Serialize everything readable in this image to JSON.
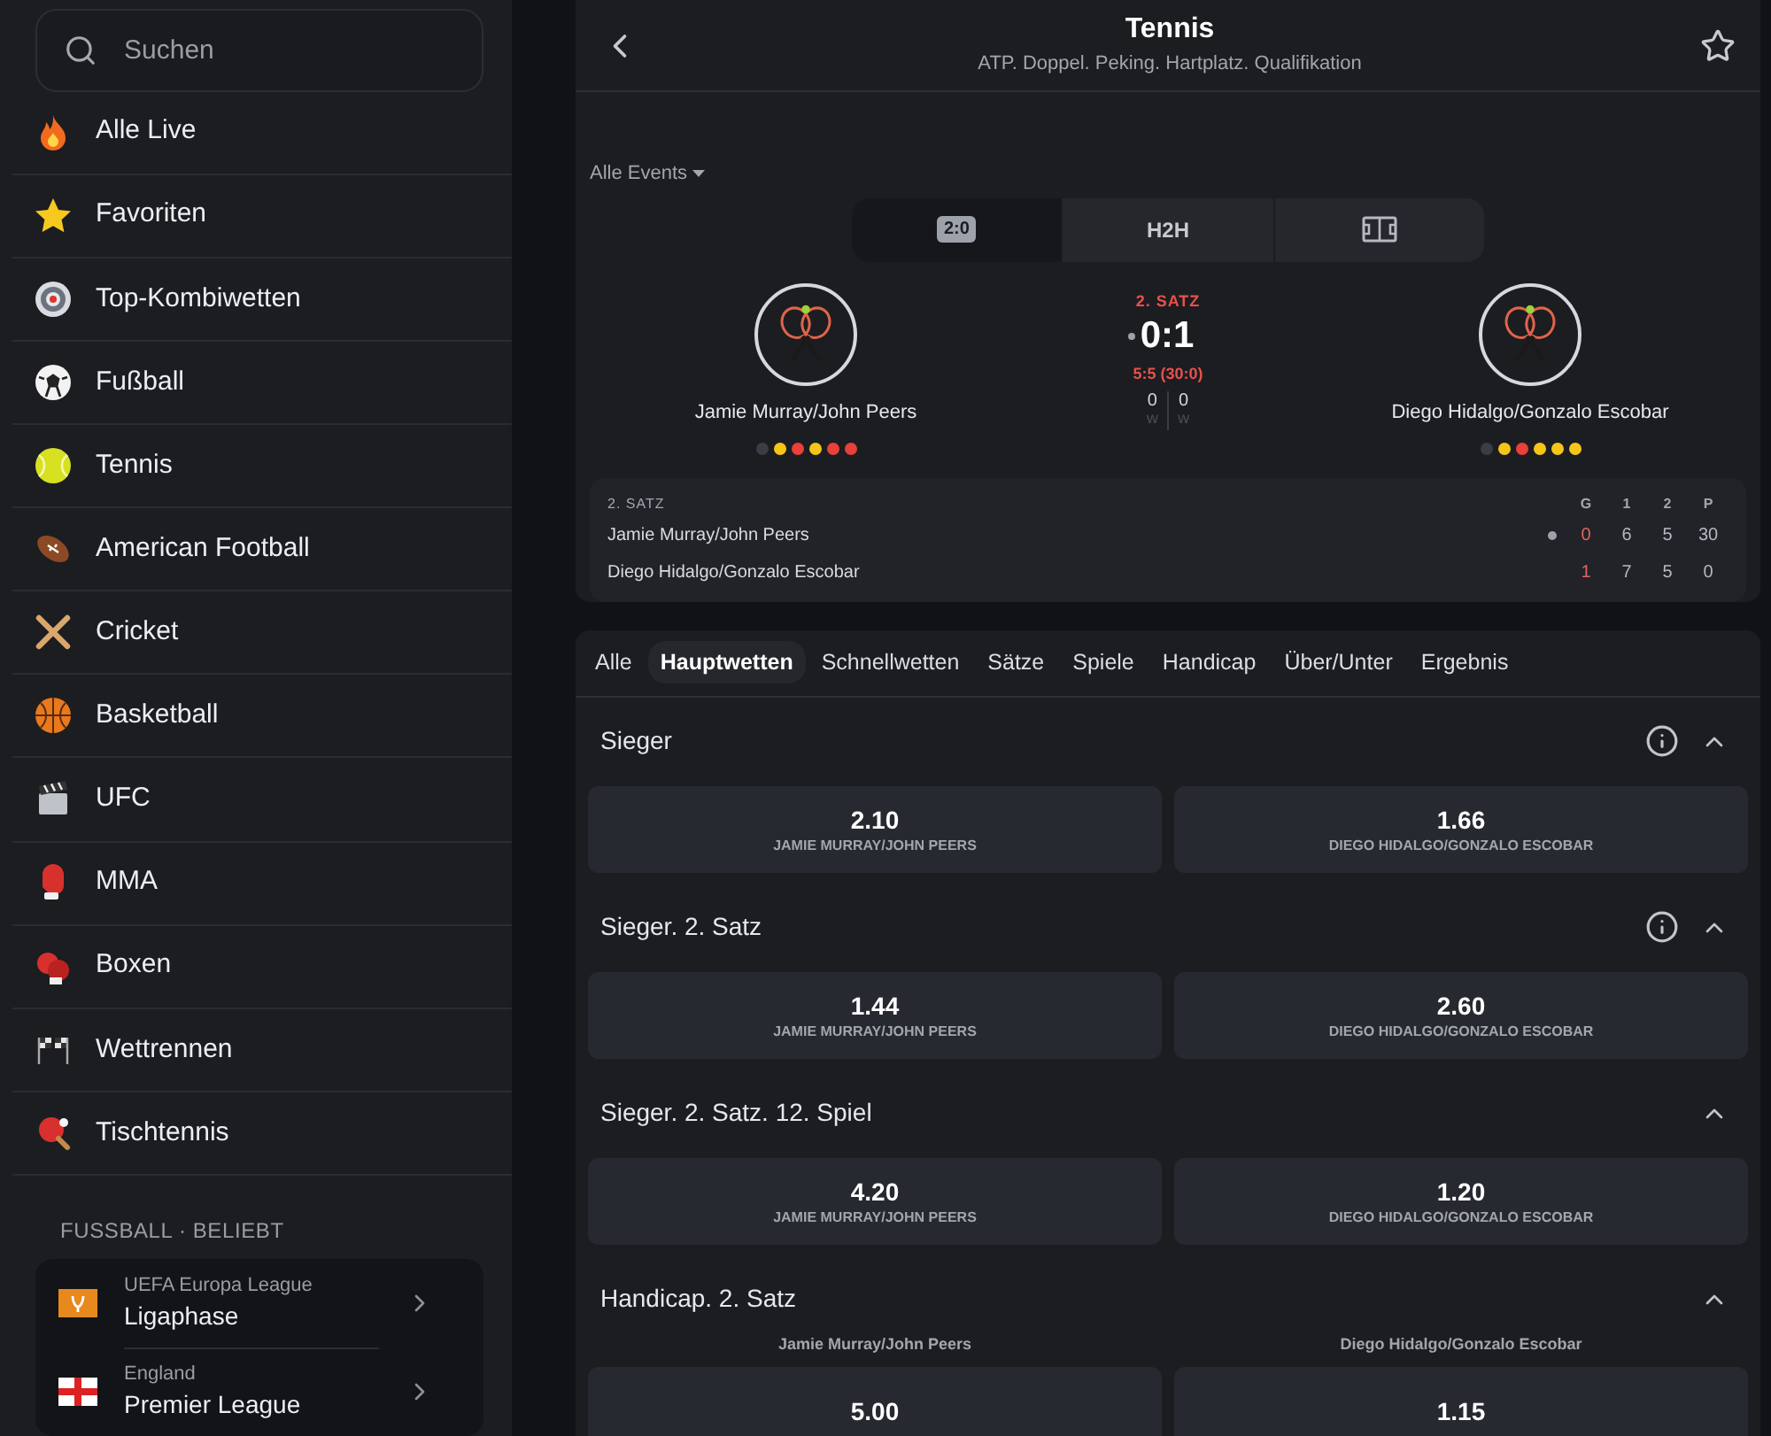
{
  "sidebar": {
    "search": {
      "placeholder": "Suchen"
    },
    "items": [
      {
        "label": "Alle Live"
      },
      {
        "label": "Favoriten"
      },
      {
        "label": "Top-Kombiwetten"
      },
      {
        "label": "Fußball"
      },
      {
        "label": "Tennis"
      },
      {
        "label": "American Football"
      },
      {
        "label": "Cricket"
      },
      {
        "label": "Basketball"
      },
      {
        "label": "UFC"
      },
      {
        "label": "MMA"
      },
      {
        "label": "Boxen"
      },
      {
        "label": "Wettrennen"
      },
      {
        "label": "Tischtennis"
      }
    ],
    "section_title": "FUSSBALL · BELIEBT",
    "leagues": [
      {
        "country": "UEFA Europa League",
        "name": "Ligaphase"
      },
      {
        "country": "England",
        "name": "Premier League"
      }
    ]
  },
  "event": {
    "title": "Tennis",
    "subtitle": "ATP. Doppel. Peking. Hartplatz. Qualifikation",
    "filter": "Alle Events",
    "view_tabs": [
      {
        "kind": "score",
        "label": "2:0",
        "selected": true
      },
      {
        "kind": "text",
        "label": "H2H",
        "selected": false
      },
      {
        "kind": "field",
        "selected": false
      }
    ],
    "teams": [
      {
        "name": "Jamie Murray/John Peers",
        "form": [
          {
            "color": "#3a3d45"
          },
          {
            "color": "#f5c518"
          },
          {
            "color": "#e8403a"
          },
          {
            "color": "#f5c518"
          },
          {
            "color": "#e8403a"
          },
          {
            "color": "#e8403a"
          }
        ]
      },
      {
        "name": "Diego Hidalgo/Gonzalo Escobar",
        "form": [
          {
            "color": "#3a3d45"
          },
          {
            "color": "#f5c518"
          },
          {
            "color": "#e8403a"
          },
          {
            "color": "#f5c518"
          },
          {
            "color": "#f5c518"
          },
          {
            "color": "#f5c518"
          }
        ]
      }
    ],
    "set_label": "2. SATZ",
    "score": "0:1",
    "game_score": "5:5 (30:0)",
    "wins": [
      {
        "value": "0",
        "label": "W"
      },
      {
        "value": "0",
        "label": "W"
      }
    ],
    "scoreboard": {
      "title": "2. SATZ",
      "columns": [
        "G",
        "1",
        "2",
        "P"
      ],
      "rows": [
        {
          "name": "Jamie Murray/John Peers",
          "serving": true,
          "values": [
            "0",
            "6",
            "5",
            "30"
          ]
        },
        {
          "name": "Diego Hidalgo/Gonzalo Escobar",
          "serving": false,
          "values": [
            "1",
            "7",
            "5",
            "0"
          ]
        }
      ]
    }
  },
  "market_tabs": [
    {
      "label": "Alle",
      "selected": false
    },
    {
      "label": "Hauptwetten",
      "selected": true
    },
    {
      "label": "Schnellwetten",
      "selected": false
    },
    {
      "label": "Sätze",
      "selected": false
    },
    {
      "label": "Spiele",
      "selected": false
    },
    {
      "label": "Handicap",
      "selected": false
    },
    {
      "label": "Über/Unter",
      "selected": false
    },
    {
      "label": "Ergebnis",
      "selected": false
    }
  ],
  "markets": [
    {
      "title": "Sieger",
      "info": true,
      "expanded": true,
      "outcomes": [
        {
          "odds": "2.10",
          "label": "JAMIE MURRAY/JOHN PEERS"
        },
        {
          "odds": "1.66",
          "label": "DIEGO HIDALGO/GONZALO ESCOBAR"
        }
      ]
    },
    {
      "title": "Sieger. 2. Satz",
      "info": true,
      "expanded": true,
      "outcomes": [
        {
          "odds": "1.44",
          "label": "JAMIE MURRAY/JOHN PEERS"
        },
        {
          "odds": "2.60",
          "label": "DIEGO HIDALGO/GONZALO ESCOBAR"
        }
      ]
    },
    {
      "title": "Sieger. 2. Satz. 12. Spiel",
      "info": false,
      "expanded": true,
      "outcomes": [
        {
          "odds": "4.20",
          "label": "JAMIE MURRAY/JOHN PEERS"
        },
        {
          "odds": "1.20",
          "label": "DIEGO HIDALGO/GONZALO ESCOBAR"
        }
      ]
    },
    {
      "title": "Handicap. 2. Satz",
      "info": false,
      "expanded": true,
      "headers": [
        "Jamie Murray/John Peers",
        "Diego Hidalgo/Gonzalo Escobar"
      ],
      "outcomes": [
        {
          "odds": "5.00"
        },
        {
          "odds": "1.15"
        }
      ]
    }
  ]
}
